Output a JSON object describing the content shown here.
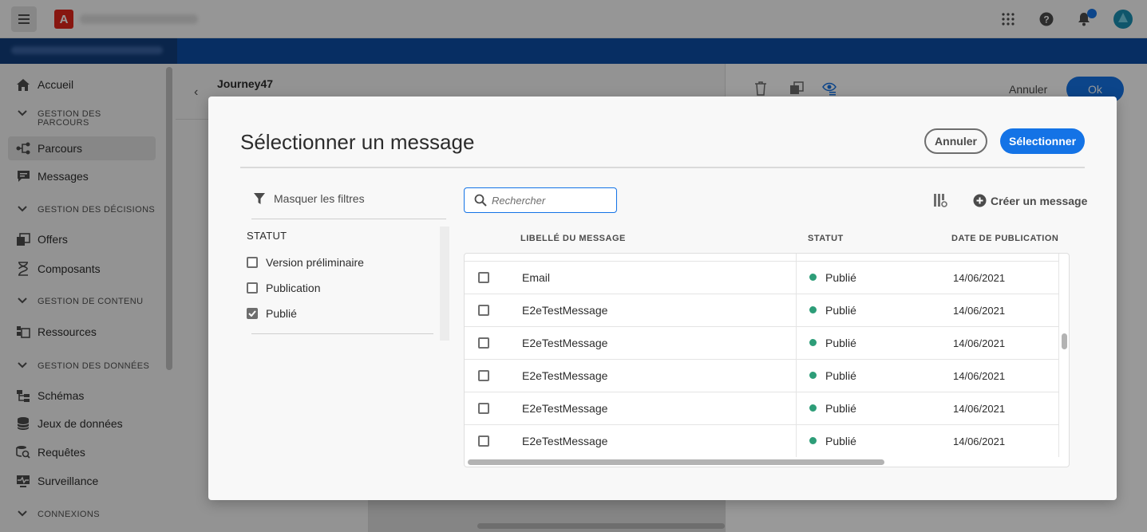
{
  "topbar": {
    "menu_icon": "hamburger-icon",
    "logo_letter": "A",
    "icons": [
      "apps-grid-icon",
      "help-icon",
      "bell-icon",
      "avatar"
    ]
  },
  "sidebar": {
    "items": [
      {
        "label": "Accueil",
        "icon": "home-icon"
      },
      {
        "section": "GESTION DES PARCOURS"
      },
      {
        "label": "Parcours",
        "icon": "journey-icon",
        "active": true
      },
      {
        "label": "Messages",
        "icon": "message-icon"
      },
      {
        "section": "GESTION DES DÉCISIONS"
      },
      {
        "label": "Offers",
        "icon": "offers-icon"
      },
      {
        "label": "Composants",
        "icon": "components-icon"
      },
      {
        "section": "GESTION DE CONTENU"
      },
      {
        "label": "Ressources",
        "icon": "assets-icon"
      },
      {
        "section": "GESTION DES DONNÉES"
      },
      {
        "label": "Schémas",
        "icon": "schema-icon"
      },
      {
        "label": "Jeux de données",
        "icon": "datasets-icon"
      },
      {
        "label": "Requêtes",
        "icon": "queries-icon"
      },
      {
        "label": "Surveillance",
        "icon": "monitoring-icon"
      },
      {
        "section": "CONNEXIONS"
      }
    ]
  },
  "background": {
    "journey_title": "Journey47",
    "cancel_label": "Annuler",
    "ok_label": "Ok"
  },
  "dialog": {
    "title": "Sélectionner un message",
    "cancel_label": "Annuler",
    "select_label": "Sélectionner",
    "hide_filters_label": "Masquer les filtres",
    "status_heading": "STATUT",
    "filters": [
      {
        "label": "Version préliminaire",
        "checked": false
      },
      {
        "label": "Publication",
        "checked": false
      },
      {
        "label": "Publié",
        "checked": true
      }
    ],
    "search_placeholder": "Rechercher",
    "create_label": "Créer un message",
    "columns": {
      "name": "LIBELLÉ DU MESSAGE",
      "status": "STATUT",
      "date": "DATE DE PUBLICATION"
    },
    "rows": [
      {
        "name": "Email",
        "status": "Publié",
        "date": "14/06/2021"
      },
      {
        "name": "E2eTestMessage",
        "status": "Publié",
        "date": "14/06/2021"
      },
      {
        "name": "E2eTestMessage",
        "status": "Publié",
        "date": "14/06/2021"
      },
      {
        "name": "E2eTestMessage",
        "status": "Publié",
        "date": "14/06/2021"
      },
      {
        "name": "E2eTestMessage",
        "status": "Publié",
        "date": "14/06/2021"
      },
      {
        "name": "E2eTestMessage",
        "status": "Publié",
        "date": "14/06/2021"
      }
    ]
  },
  "colors": {
    "accent": "#1473e6",
    "header_blue": "#0d4ea6",
    "published_green": "#2d9d78",
    "adobe_red": "#e1251b"
  }
}
